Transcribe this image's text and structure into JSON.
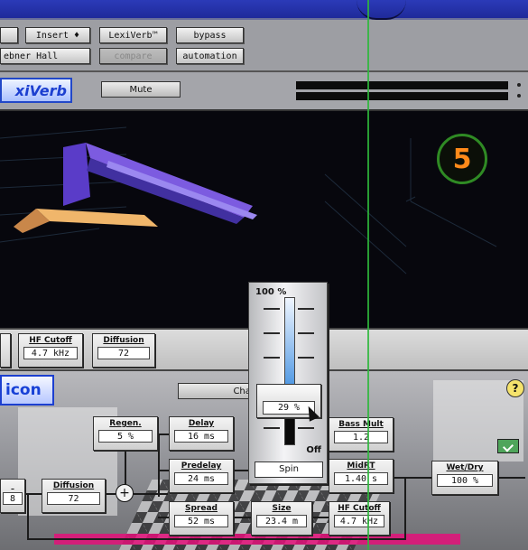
{
  "toolbar": {
    "buttons": [
      "Insert ♦",
      "LexiVerb™",
      "bypass",
      "ebner Hall",
      "compare",
      "automation"
    ]
  },
  "plugin": {
    "logo": "xiVerb",
    "mute_label": "Mute"
  },
  "badge": {
    "number": "5"
  },
  "midbar": {
    "params": [
      {
        "label": "HF Cutoff",
        "value": "4.7 kHz"
      },
      {
        "label": "Diffusion",
        "value": "72"
      }
    ]
  },
  "panel": {
    "logo": "icon",
    "char_tab": "Char",
    "help": "?"
  },
  "nodes": {
    "regen": {
      "label": "Regen.",
      "value": "5 %"
    },
    "delay": {
      "label": "Delay",
      "value": "16 ms"
    },
    "predelay": {
      "label": "Predelay",
      "value": "24 ms"
    },
    "spread": {
      "label": "Spread",
      "value": "52 ms"
    },
    "diffusion": {
      "label": "Diffusion",
      "value": "72"
    },
    "left_stub": {
      "value": "8"
    },
    "bass_mult": {
      "label": "Bass Mult",
      "value": "1.2"
    },
    "mid_rt": {
      "label": "MidRT",
      "value": "1.40 s"
    },
    "size": {
      "label": "Size",
      "value": "23.4 m"
    },
    "hf_cutoff": {
      "label": "HF Cutoff",
      "value": "4.7 kHz"
    },
    "wet_dry": {
      "label": "Wet/Dry",
      "value": "100 %"
    },
    "sum_symbol": "+"
  },
  "slider": {
    "top_label": "100 %",
    "value": "29 %",
    "level": 0.29,
    "off_label": "Off",
    "mode": "Spin"
  },
  "colors": {
    "accent_blue": "#1c3fd0",
    "badge_ring": "#2f8a24",
    "badge_text": "#ff8a1a",
    "pink_line": "#e4107a"
  }
}
